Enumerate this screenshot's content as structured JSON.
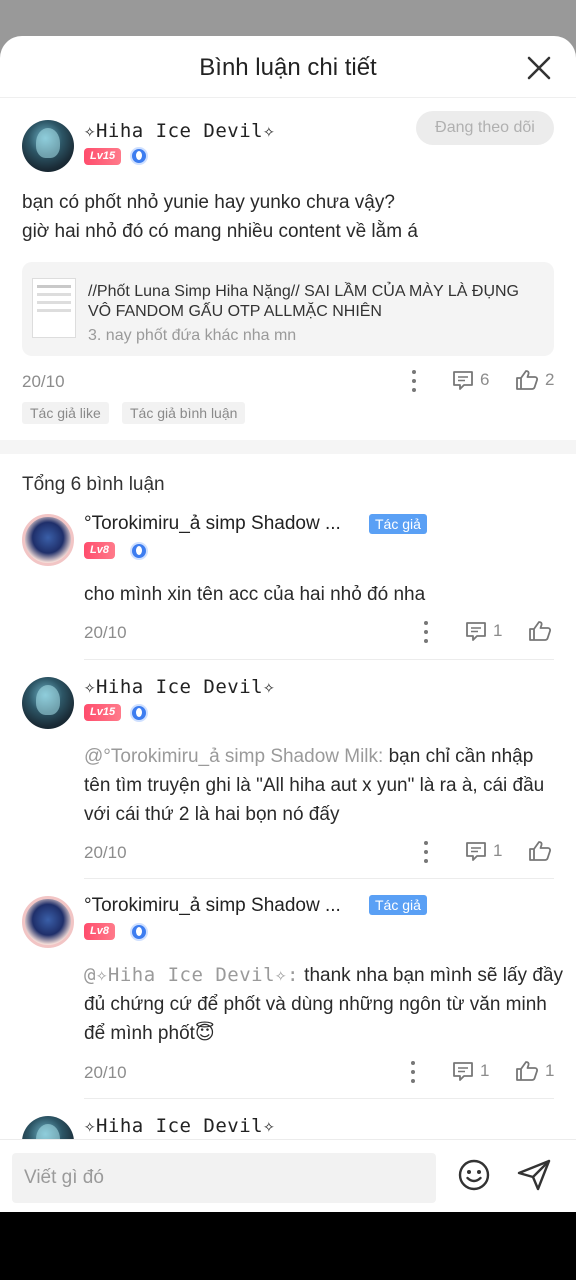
{
  "header": {
    "title": "Bình luận chi tiết"
  },
  "post": {
    "author": "✧Hiha Ice Devil✧",
    "level": "Lv15",
    "follow_label": "Đang theo dõi",
    "text_line1": "bạn có phốt nhỏ yunie hay yunko chưa vậy?",
    "text_line2": "giờ hai nhỏ đó có mang nhiều content về lằm á",
    "card_title": "//Phốt Luna Simp Hiha Nặng// SAI LẦM CỦA MÀY LÀ ĐỤNG VÔ FANDOM GẤU OTP ALLMẶC NHIÊN",
    "card_sub": "3. nay phốt đứa khác nha mn",
    "date": "20/10",
    "comment_count": "6",
    "like_count": "2",
    "chip_like": "Tác giả like",
    "chip_comment": "Tác giả bình luận"
  },
  "total_label": "Tổng 6 bình luận",
  "comments": [
    {
      "author": "°Torokimiru_ả simp Shadow ...",
      "author_tag": "Tác giả",
      "level": "Lv8",
      "text": "cho mình xin tên acc của hai nhỏ đó nha",
      "date": "20/10",
      "comment_count": "1"
    },
    {
      "author": "✧Hiha Ice Devil✧",
      "level": "Lv15",
      "mention": "@°Torokimiru_ả simp Shadow Milk:",
      "text": " bạn chỉ cần nhập tên tìm truyện ghi là \"All hiha aut x yun\" là ra à, cái đầu với cái thứ 2 là hai bọn nó đấy",
      "date": "20/10",
      "comment_count": "1"
    },
    {
      "author": "°Torokimiru_ả simp Shadow ...",
      "author_tag": "Tác giả",
      "level": "Lv8",
      "mention": "@✧Hiha Ice Devil✧:",
      "text": " thank nha bạn mình sẽ lấy đầy đủ chứng cứ để phốt và dùng những ngôn từ văn minh để mình phốt😇",
      "date": "20/10",
      "comment_count": "1",
      "like_count": "1"
    },
    {
      "author": "✧Hiha Ice Devil✧"
    }
  ],
  "composer": {
    "placeholder": "Viết gì đó"
  }
}
